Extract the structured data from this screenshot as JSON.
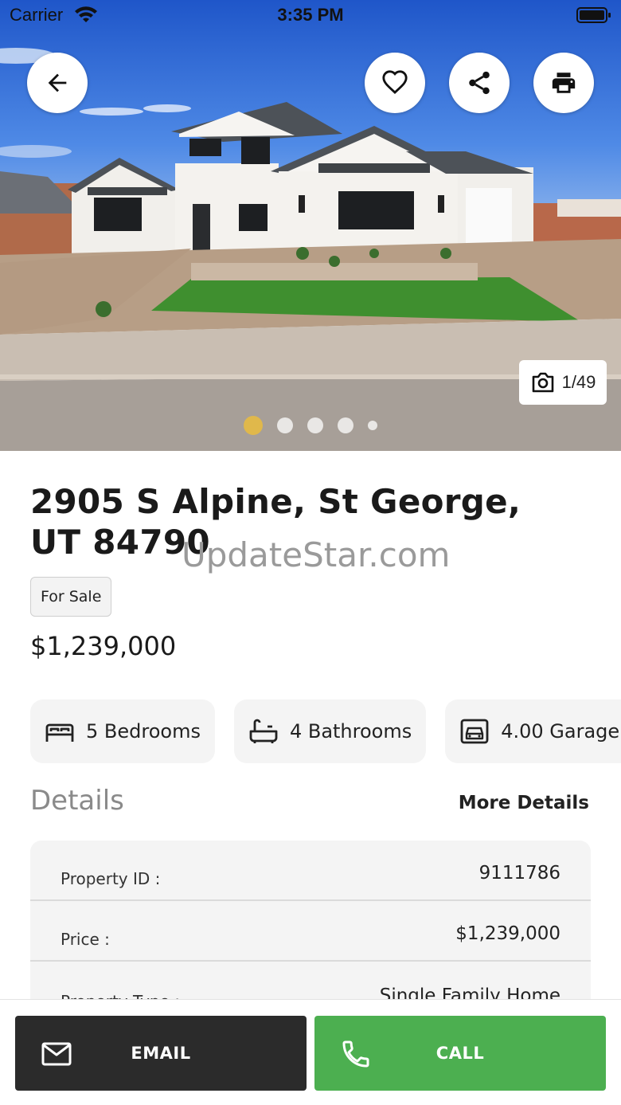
{
  "status_bar": {
    "carrier": "Carrier",
    "time": "3:35 PM"
  },
  "hero": {
    "photo_counter": "1/49",
    "carousel_dots": 5,
    "active_dot": 0
  },
  "listing": {
    "address": "2905 S Alpine, St George, UT 84790",
    "status_badge": "For Sale",
    "price": "$1,239,000"
  },
  "watermark": "UpdateStar.com",
  "features": [
    {
      "icon": "bed-icon",
      "label": "5  Bedrooms"
    },
    {
      "icon": "bathtub-icon",
      "label": "4  Bathrooms"
    },
    {
      "icon": "car-icon",
      "label": "4.00  Garage"
    }
  ],
  "details": {
    "title": "Details",
    "more_label": "More Details",
    "rows": [
      {
        "label": "Property ID :",
        "value": "9111786"
      },
      {
        "label": "Price :",
        "value": "$1,239,000"
      },
      {
        "label": "Property Type :",
        "value": "Single Family Home"
      }
    ]
  },
  "actions": {
    "email_label": "EMAIL",
    "call_label": "CALL"
  },
  "colors": {
    "accent_call": "#4caf50",
    "email_bg": "#2b2b2b",
    "active_dot": "#e0b84b"
  }
}
